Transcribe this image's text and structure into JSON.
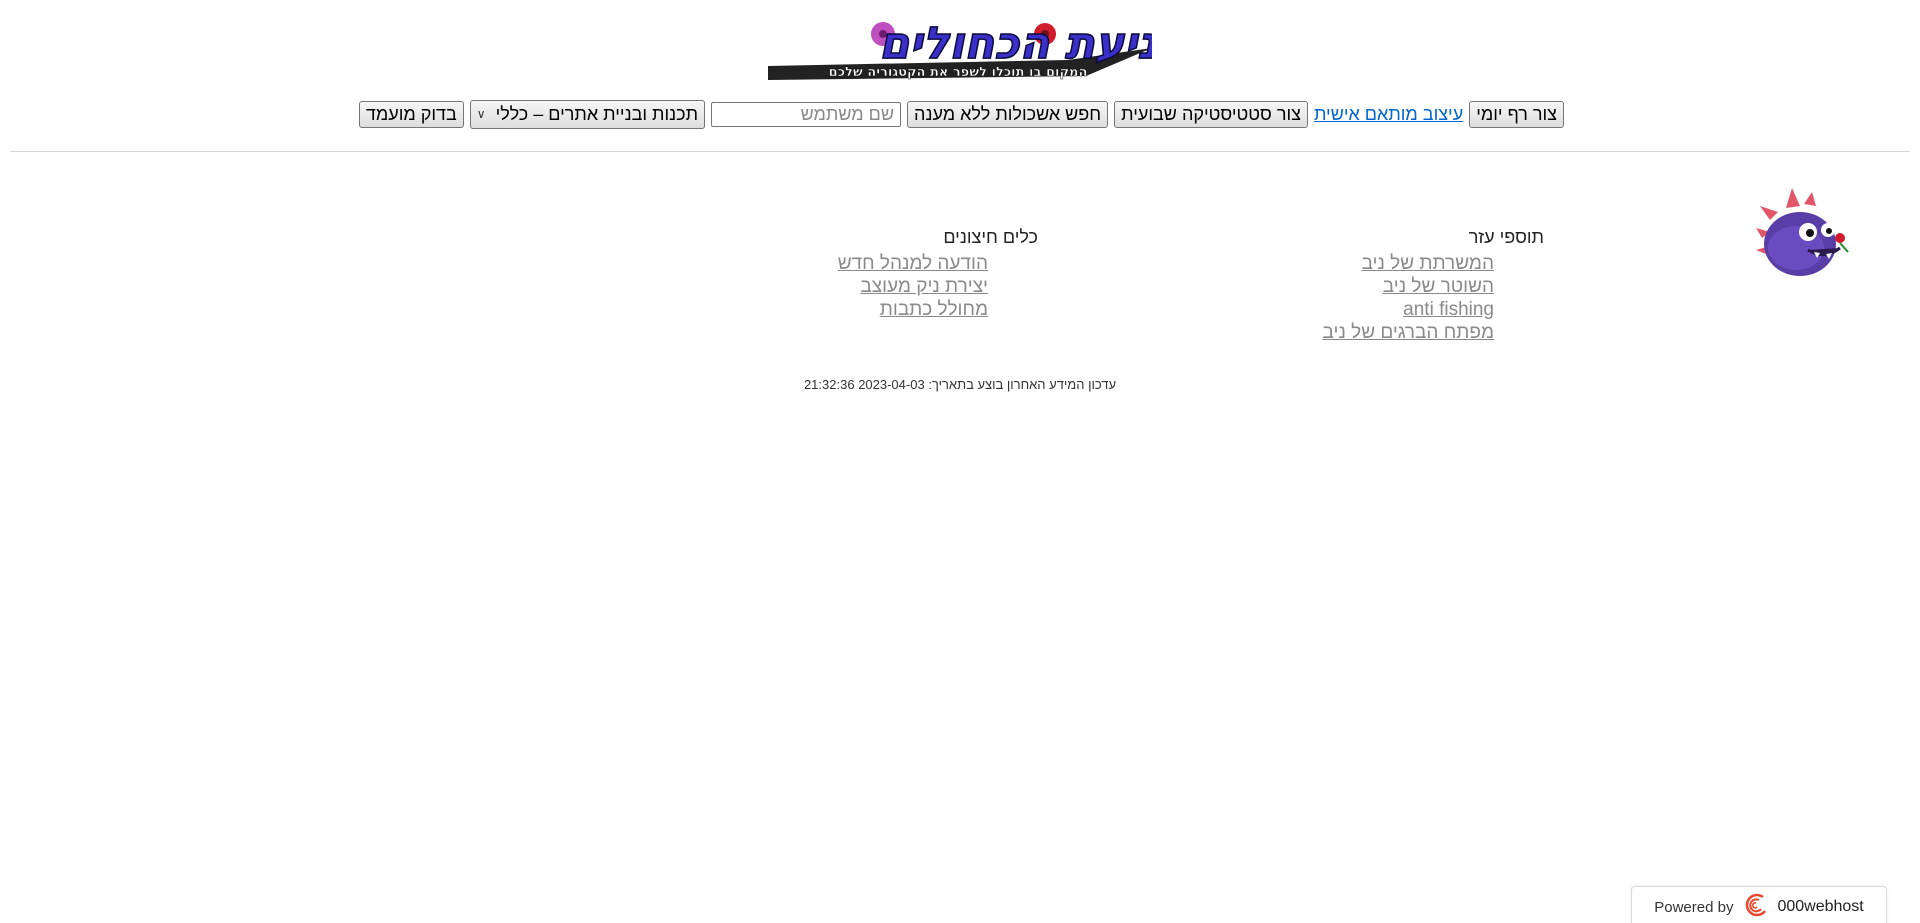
{
  "header": {
    "logo_title": "ניעת הכחולים",
    "logo_tagline": "המקום בו תוכלו לשפר את הקטגוריה שלכם"
  },
  "toolbar": {
    "daily_graph_button": "צור רף יומי",
    "custom_design_link": "עיצוב מותאם אישית",
    "weekly_stats_button": "צור סטטיסטיקה שבועית",
    "unanswered_polls_button": "חפש אשכולות ללא מענה",
    "username_placeholder": "שם משתמש",
    "username_value": "",
    "category_select": {
      "selected": "תכנות ובניית אתרים – כללי"
    },
    "check_candidate_button": "בדוק מועמד"
  },
  "columns": {
    "helpers": {
      "title": "תוספי עזר",
      "links": [
        "המשרתת של ניב",
        "השוטר של ניב",
        "anti fishing",
        "מפתח הברגים של ניב"
      ]
    },
    "external_tools": {
      "title": "כלים חיצונים",
      "links": [
        "הודעה למנהל חדש",
        "יצירת ניק מעוצב",
        "מחולל כתבות"
      ]
    }
  },
  "footer": {
    "last_update_label": "עדכון המידע האחרון בוצע בתאריך:",
    "last_update_value": "2023-04-03 21:32:36"
  },
  "powered_badge": {
    "prefix": "Powered by",
    "brand": "000webhost"
  },
  "icons": {
    "mascot": "purple-monster-icon",
    "dropdown": "chevron-down-icon",
    "brand": "webhost-swirl-icon"
  },
  "colors": {
    "link_blue": "#0066cc",
    "link_gray": "#8a8a8a",
    "mascot_purple": "#5a3ea8",
    "brand_red": "#e8482f"
  }
}
